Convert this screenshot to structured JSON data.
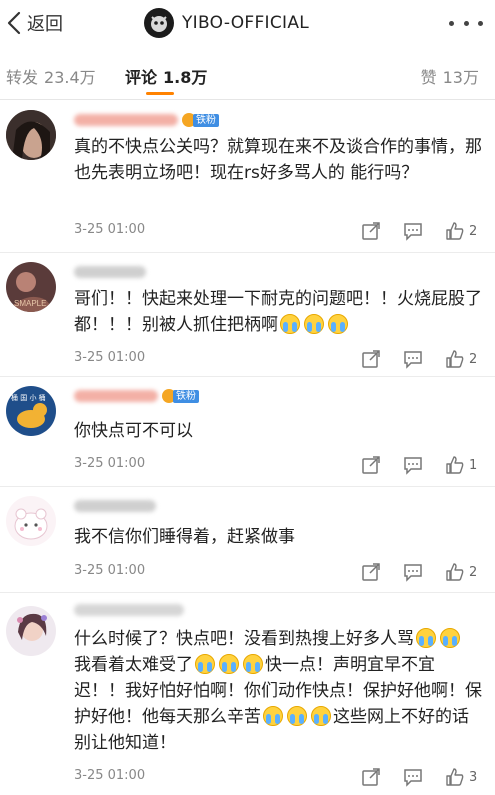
{
  "header": {
    "back_label": "返回",
    "title": "YIBO-OFFICIAL"
  },
  "tabs": {
    "repost_label": "转发",
    "repost_count": "23.4万",
    "comment_label": "评论",
    "comment_count": "1.8万",
    "like_label": "赞",
    "like_count": "13万",
    "accent_color": "#ff8200"
  },
  "comments": [
    {
      "text": "真的不快点公关吗？就算现在来不及谈合作的事情，那也先表明立场吧！现在rs好多骂人的 能行吗？",
      "badge": "铁粉",
      "time": "3-25 01:00",
      "likes": "2"
    },
    {
      "text_parts": [
        "哥们！！快起来处理一下耐克的问题吧！！火烧屁股了都！！！别被人抓住把柄啊"
      ],
      "time": "3-25 01:00",
      "likes": "2"
    },
    {
      "text": "你快点可不可以",
      "badge": "铁粉",
      "time": "3-25 01:00",
      "likes": "1"
    },
    {
      "text": "我不信你们睡得着，赶紧做事",
      "time": "3-25 01:00",
      "likes": "2"
    },
    {
      "text_parts": [
        "什么时候了？快点吧！没看到热搜上好多人骂",
        "我看着太难受了",
        "快一点！声明宜早不宜迟！！我好怕好怕啊！你们动作快点！保护好他啊！保护好他！他每天那么辛苦",
        "这些网上不好的话别让他知道！"
      ],
      "time": "3-25 01:00",
      "likes": "3"
    }
  ]
}
